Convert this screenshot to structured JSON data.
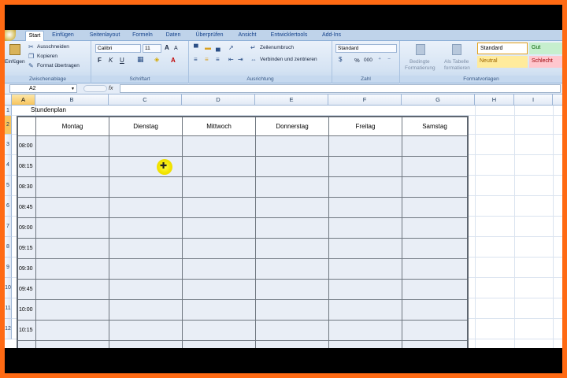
{
  "ribbon": {
    "tabs": [
      {
        "label": "Start",
        "active": true
      },
      {
        "label": "Einfügen"
      },
      {
        "label": "Seitenlayout"
      },
      {
        "label": "Formeln"
      },
      {
        "label": "Daten"
      },
      {
        "label": "Überprüfen"
      },
      {
        "label": "Ansicht"
      },
      {
        "label": "Entwicklertools"
      },
      {
        "label": "Add-Ins"
      }
    ],
    "clipboard": {
      "paste_label": "Einfügen",
      "cut_label": "Ausschneiden",
      "copy_label": "Kopieren",
      "format_painter_label": "Format übertragen",
      "group_label": "Zwischenablage"
    },
    "font": {
      "font_name": "Calibri",
      "font_size": "11",
      "bold": "F",
      "italic": "K",
      "underline": "U",
      "grow": "A",
      "shrink": "A",
      "font_color": "A",
      "group_label": "Schriftart"
    },
    "alignment": {
      "wrap_label": "Zeilenumbruch",
      "merge_label": "Verbinden und zentrieren",
      "group_label": "Ausrichtung"
    },
    "number": {
      "format": "Standard",
      "percent": "%",
      "thousands": "000",
      "group_label": "Zahl"
    },
    "styles": {
      "conditional_label_1": "Bedingte",
      "conditional_label_2": "Formatierung",
      "as_table_label_1": "Als Tabelle",
      "as_table_label_2": "formatieren",
      "cells": [
        {
          "label": "Standard",
          "bg": "#ffffff",
          "fg": "#000000"
        },
        {
          "label": "Gut",
          "bg": "#c6efce",
          "fg": "#006100"
        },
        {
          "label": "Neutral",
          "bg": "#ffeb9c",
          "fg": "#9c6500"
        },
        {
          "label": "Schlecht",
          "bg": "#ffc7ce",
          "fg": "#9c0006"
        }
      ],
      "group_label": "Formatvorlagen"
    }
  },
  "formula_bar": {
    "name_box": "A2",
    "fx": "fx",
    "formula": ""
  },
  "sheet": {
    "columns": [
      "A",
      "B",
      "C",
      "D",
      "E",
      "F",
      "G",
      "H",
      "I"
    ],
    "selected_column": "A",
    "rows": [
      "1",
      "2",
      "3",
      "4",
      "5",
      "6",
      "7",
      "8",
      "9",
      "10",
      "11",
      "12"
    ],
    "selected_row": "2",
    "title": "Stundenplan",
    "days": [
      "Montag",
      "Dienstag",
      "Mittwoch",
      "Donnerstag",
      "Freitag",
      "Samstag"
    ],
    "times": [
      "08:00",
      "08:15",
      "08:30",
      "08:45",
      "09:00",
      "09:15",
      "09:30",
      "09:45",
      "10:00",
      "10:15"
    ]
  },
  "colors": {
    "frame": "#ff6a13",
    "table_fill": "#e9eef6",
    "selection": "#f7c45e",
    "cursor_highlight": "#f2e300"
  }
}
